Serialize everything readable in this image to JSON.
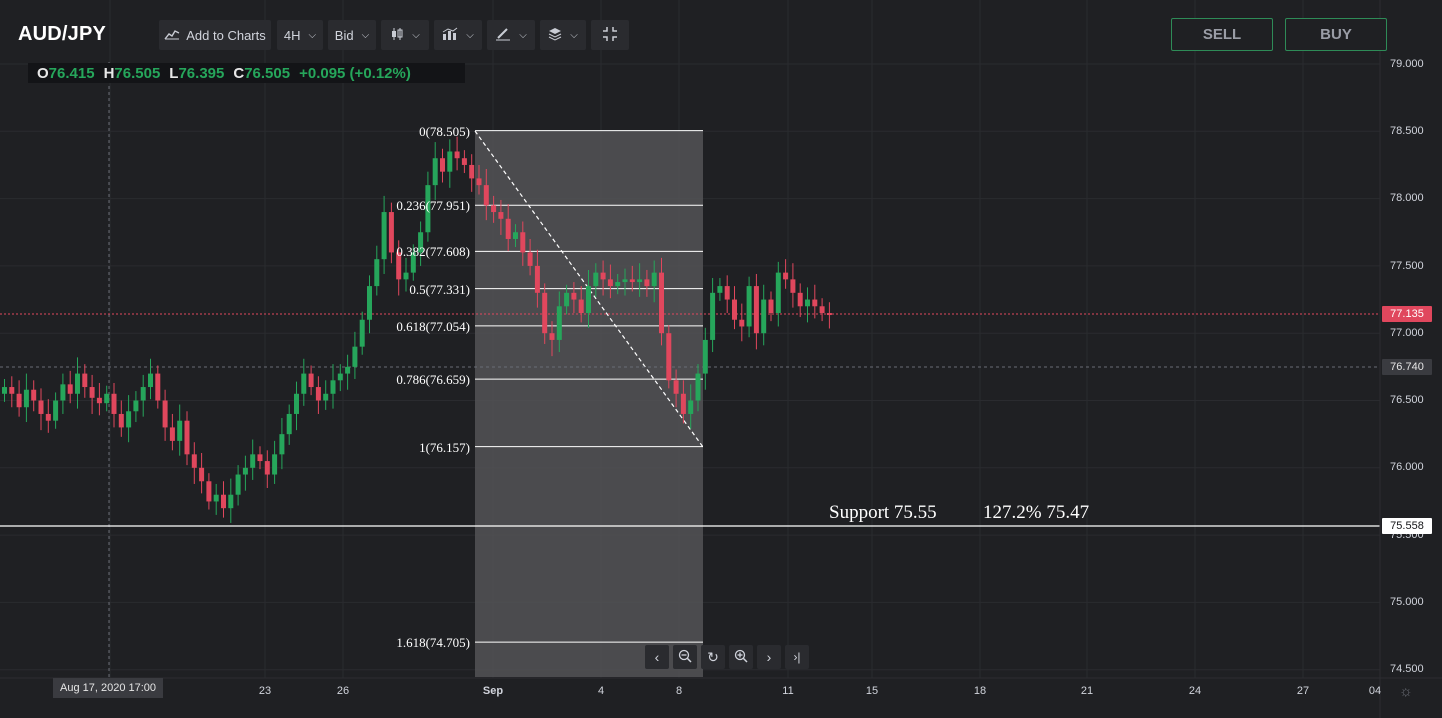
{
  "symbol": "AUD/JPY",
  "toolbar": {
    "add_to_charts": "Add to Charts",
    "interval": "4H",
    "price_type": "Bid"
  },
  "ohlc": {
    "o_key": "O",
    "o": "76.415",
    "h_key": "H",
    "h": "76.505",
    "l_key": "L",
    "l": "76.395",
    "c_key": "C",
    "c": "76.505",
    "change": "+0.095 (+0.12%)"
  },
  "trade": {
    "sell": "SELL",
    "buy": "BUY"
  },
  "y_axis": [
    "79.000",
    "78.500",
    "78.000",
    "77.500",
    "77.000",
    "76.500",
    "76.000",
    "75.500",
    "75.000",
    "74.500"
  ],
  "x_axis": [
    "23",
    "26",
    "Sep",
    "4",
    "8",
    "11",
    "15",
    "18",
    "21",
    "24",
    "27",
    "04"
  ],
  "crosshair_x_label": "Aug 17, 2020   17:00",
  "price_tags": {
    "current": "77.135",
    "crosshair": "76.740",
    "support_line": "75.558"
  },
  "fib_levels": [
    {
      "label": "0(78.505)",
      "price": 78.505
    },
    {
      "label": "0.236(77.951)",
      "price": 77.951
    },
    {
      "label": "0.382(77.608)",
      "price": 77.608
    },
    {
      "label": "0.5(77.331)",
      "price": 77.331
    },
    {
      "label": "0.618(77.054)",
      "price": 77.054
    },
    {
      "label": "0.786(76.659)",
      "price": 76.659
    },
    {
      "label": "1(76.157)",
      "price": 76.157
    },
    {
      "label": "1.618(74.705)",
      "price": 74.705
    }
  ],
  "annotations": {
    "support": "Support 75.55",
    "extension": "127.2% 75.47"
  },
  "colors": {
    "background": "#1f2023",
    "up": "#26a65b",
    "down": "#e0475d",
    "fib_zone": "#545456",
    "current_price": "#e0475d",
    "accent_border": "#2e8b57"
  },
  "chart_data": {
    "type": "candlestick",
    "title": "AUD/JPY",
    "ylim": [
      74.45,
      79.1
    ],
    "interval": "4H",
    "series_close": [
      76.6,
      76.55,
      76.45,
      76.58,
      76.5,
      76.4,
      76.35,
      76.5,
      76.62,
      76.55,
      76.7,
      76.6,
      76.52,
      76.48,
      76.55,
      76.4,
      76.3,
      76.42,
      76.5,
      76.6,
      76.7,
      76.5,
      76.3,
      76.2,
      76.35,
      76.1,
      76.0,
      75.9,
      75.75,
      75.8,
      75.7,
      75.8,
      75.95,
      76.0,
      76.1,
      76.05,
      75.95,
      76.1,
      76.25,
      76.4,
      76.55,
      76.7,
      76.6,
      76.5,
      76.55,
      76.65,
      76.7,
      76.75,
      76.9,
      77.1,
      77.35,
      77.55,
      77.9,
      77.6,
      77.4,
      77.45,
      77.6,
      77.75,
      78.1,
      78.3,
      78.2,
      78.35,
      78.3,
      78.25,
      78.15,
      78.1,
      77.95,
      77.9,
      77.85,
      77.7,
      77.75,
      77.6,
      77.5,
      77.3,
      77.0,
      76.95,
      77.2,
      77.3,
      77.25,
      77.15,
      77.35,
      77.45,
      77.4,
      77.35,
      77.38,
      77.4,
      77.38,
      77.4,
      77.35,
      77.45,
      77.0,
      76.65,
      76.55,
      76.4,
      76.5,
      76.7,
      76.95,
      77.3,
      77.35,
      77.25,
      77.1,
      77.05,
      77.35,
      77.0,
      77.25,
      77.15,
      77.45,
      77.4,
      77.3,
      77.2,
      77.25,
      77.2,
      77.15,
      77.135
    ],
    "support": 75.558,
    "support_label": "Support 75.55",
    "extension_label": "127.2% 75.47"
  }
}
